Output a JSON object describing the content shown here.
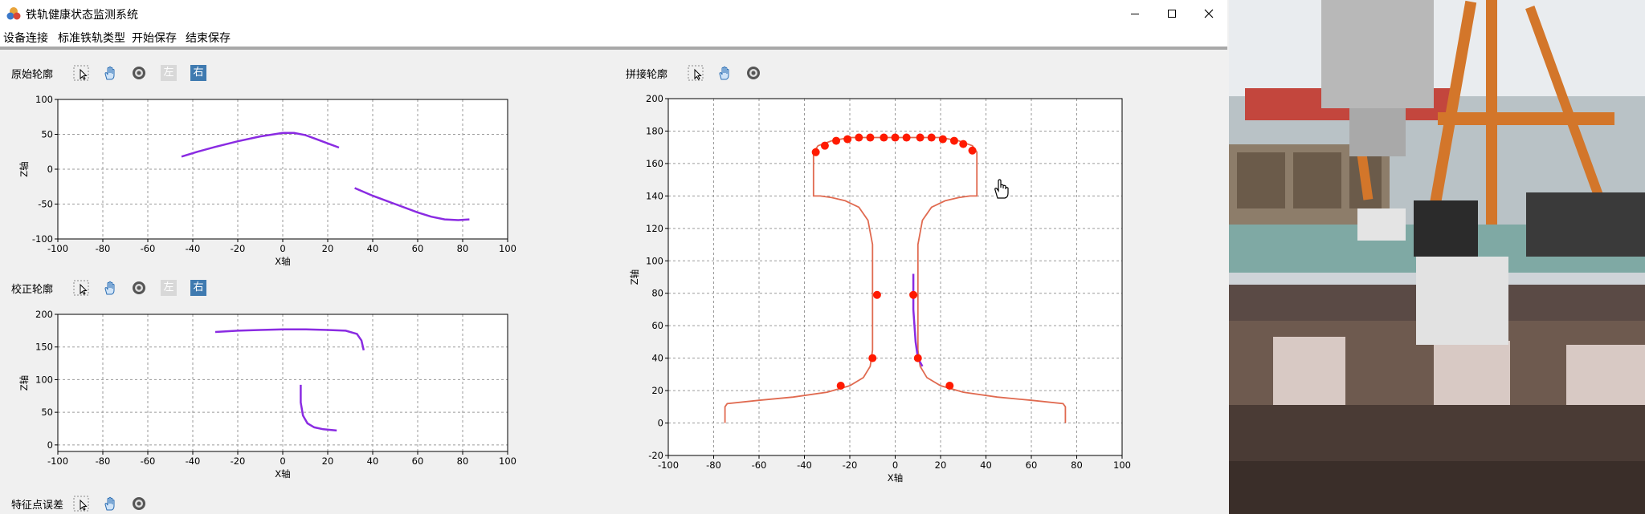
{
  "window": {
    "title": "铁轨健康状态监测系统"
  },
  "menu": [
    "设备连接",
    "标准铁轨类型",
    "开始保存",
    "结束保存"
  ],
  "sections": {
    "raw": "原始轮廓",
    "corrected": "校正轮廓",
    "stitched": "拼接轮廓",
    "feature_error": "特征点误差"
  },
  "toolbar": {
    "left_label": "左",
    "right_label": "右"
  },
  "colors": {
    "profile": "#8a2be2",
    "rail_outline": "#e06a50",
    "feature_point": "#ff1a00",
    "grid": "#9a9a9a"
  },
  "chart_data": [
    {
      "id": "raw-profile",
      "type": "scatter",
      "title": "原始轮廓",
      "xlabel": "X轴",
      "ylabel": "Z轴",
      "xlim": [
        -100,
        100
      ],
      "ylim": [
        -100,
        100
      ],
      "xticks": [
        -100,
        -80,
        -60,
        -40,
        -20,
        0,
        20,
        40,
        60,
        80,
        100
      ],
      "yticks": [
        -100,
        -50,
        0,
        50,
        100
      ],
      "grid": true,
      "series": [
        {
          "x": [
            -45,
            -38,
            -30,
            -20,
            -10,
            0,
            5,
            10,
            15,
            20,
            25
          ],
          "y": [
            18,
            25,
            32,
            40,
            47,
            52,
            52,
            49,
            43,
            37,
            31
          ]
        },
        {
          "x": [
            32,
            40,
            50,
            60,
            66,
            72,
            78,
            83
          ],
          "y": [
            -27,
            -38,
            -50,
            -62,
            -68,
            -72,
            -73,
            -72
          ]
        }
      ]
    },
    {
      "id": "corrected-profile",
      "type": "scatter",
      "title": "校正轮廓",
      "xlabel": "X轴",
      "ylabel": "Z轴",
      "xlim": [
        -100,
        100
      ],
      "ylim": [
        -10,
        200
      ],
      "xticks": [
        -100,
        -80,
        -60,
        -40,
        -20,
        0,
        20,
        40,
        60,
        80,
        100
      ],
      "yticks": [
        0,
        50,
        100,
        150,
        200
      ],
      "grid": true,
      "series": [
        {
          "x": [
            -30,
            -20,
            -10,
            0,
            10,
            20,
            28,
            33,
            35,
            36
          ],
          "y": [
            173,
            175,
            176,
            177,
            177,
            176,
            175,
            170,
            160,
            145
          ]
        },
        {
          "x": [
            8,
            8,
            9,
            11,
            14,
            18,
            24
          ],
          "y": [
            92,
            65,
            45,
            33,
            27,
            24,
            22
          ]
        }
      ]
    },
    {
      "id": "stitched-profile",
      "type": "line",
      "title": "拼接轮廓",
      "xlabel": "X轴",
      "ylabel": "Z轴",
      "xlim": [
        -100,
        100
      ],
      "ylim": [
        -20,
        200
      ],
      "xticks": [
        -100,
        -80,
        -60,
        -40,
        -20,
        0,
        20,
        40,
        60,
        80,
        100
      ],
      "yticks": [
        -20,
        0,
        20,
        40,
        60,
        80,
        100,
        120,
        140,
        160,
        180,
        200
      ],
      "grid": true,
      "rail_outline": {
        "x": [
          -75,
          -75,
          -74,
          -60,
          -45,
          -30,
          -20,
          -14,
          -11,
          -10,
          -10,
          -10,
          -12,
          -16,
          -22,
          -28,
          -33,
          -36,
          -36,
          -36,
          -34,
          -28,
          -20,
          -10,
          0,
          10,
          20,
          28,
          34,
          36,
          36,
          36,
          33,
          28,
          22,
          16,
          12,
          10,
          10,
          10,
          11,
          14,
          20,
          30,
          45,
          60,
          74,
          75,
          75
        ],
        "y": [
          0,
          10,
          12,
          14,
          16,
          19,
          23,
          28,
          35,
          45,
          80,
          110,
          125,
          133,
          137,
          139,
          140,
          140,
          155,
          167,
          171,
          174,
          176,
          176,
          176,
          176,
          176,
          174,
          171,
          167,
          155,
          140,
          140,
          139,
          137,
          133,
          125,
          110,
          80,
          45,
          35,
          28,
          23,
          19,
          16,
          14,
          12,
          10,
          0
        ]
      },
      "measured_profile": {
        "x": [
          8,
          8,
          9,
          10,
          12
        ],
        "y": [
          92,
          70,
          50,
          40,
          35
        ]
      },
      "feature_points": {
        "x": [
          -35,
          -31,
          -26,
          -21,
          -16,
          -11,
          -5,
          0,
          5,
          11,
          16,
          21,
          26,
          30,
          34,
          -8,
          -10,
          -24,
          8,
          10,
          24
        ],
        "y": [
          167,
          171,
          174,
          175,
          176,
          176,
          176,
          176,
          176,
          176,
          176,
          175,
          174,
          172,
          168,
          79,
          40,
          23,
          79,
          40,
          23
        ]
      }
    }
  ]
}
